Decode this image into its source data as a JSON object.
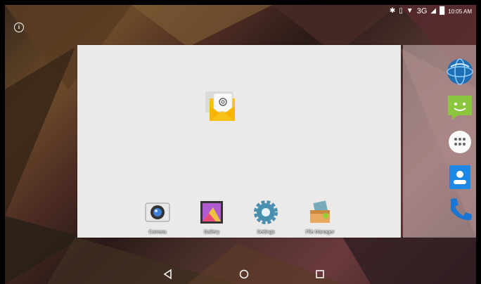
{
  "status_bar": {
    "time": "10:05 AM",
    "network": "3G",
    "icons": [
      "bluetooth-icon",
      "vibrate-icon",
      "wifi-icon",
      "signal-icon",
      "battery-icon"
    ]
  },
  "info_button": {
    "icon": "info-icon"
  },
  "home_page": {
    "widget_app": {
      "icon": "email-icon"
    },
    "dock_apps": [
      {
        "label": "Camera",
        "icon": "camera-icon"
      },
      {
        "label": "Gallery",
        "icon": "gallery-icon"
      },
      {
        "label": "Settings",
        "icon": "settings-icon"
      },
      {
        "label": "File Manager",
        "icon": "file-manager-icon"
      }
    ]
  },
  "side_dock": [
    {
      "icon": "browser-icon"
    },
    {
      "icon": "messaging-icon"
    },
    {
      "icon": "app-drawer-icon"
    },
    {
      "icon": "contacts-icon"
    },
    {
      "icon": "phone-icon"
    }
  ],
  "navigation": {
    "buttons": [
      "back-button",
      "home-button",
      "recents-button"
    ]
  },
  "colors": {
    "page_bg": "#eceae9",
    "email_yellow": "#f7c11c",
    "messaging_green": "#8cc63f",
    "contacts_blue": "#1e88e5",
    "phone_blue": "#1976d2"
  }
}
